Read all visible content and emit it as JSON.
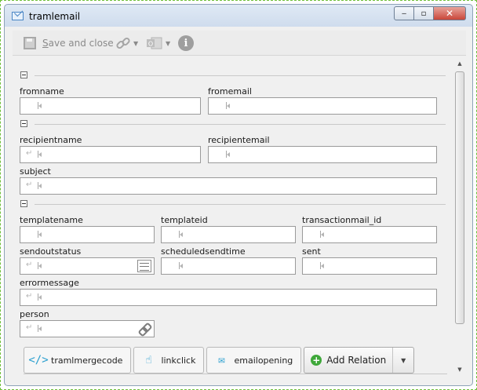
{
  "window": {
    "title": "tramlemail",
    "minimize": "‒",
    "maximize": "▫",
    "close": "✕"
  },
  "toolbar": {
    "save_and_close_underlined": "S",
    "save_and_close_rest": "ave and close",
    "link_caret": "▼",
    "office_caret": "▼",
    "info": "i"
  },
  "sections": [
    {
      "fields": [
        {
          "label": "fromname",
          "value": ""
        },
        {
          "label": "fromemail",
          "value": ""
        }
      ]
    },
    {
      "fields": [
        {
          "label": "recipientname",
          "value": ""
        },
        {
          "label": "recipientemail",
          "value": ""
        },
        {
          "label": "subject",
          "value": ""
        }
      ]
    },
    {
      "fields": [
        {
          "label": "templatename",
          "value": ""
        },
        {
          "label": "templateid",
          "value": ""
        },
        {
          "label": "transactionmail_id",
          "value": ""
        },
        {
          "label": "sendoutstatus",
          "value": ""
        },
        {
          "label": "scheduledsendtime",
          "value": ""
        },
        {
          "label": "sent",
          "value": ""
        },
        {
          "label": "errormessage",
          "value": ""
        },
        {
          "label": "person",
          "value": ""
        }
      ]
    }
  ],
  "relations": {
    "tabs": [
      {
        "label": "tramlmergecode",
        "icon": "code-icon"
      },
      {
        "label": "linkclick",
        "icon": "hand-pointer-icon"
      },
      {
        "label": "emailopening",
        "icon": "envelope-open-icon"
      }
    ],
    "add_relation_label": "Add Relation",
    "add_relation_caret": "▼"
  },
  "scrollbar": {
    "up": "▲",
    "down": "▼"
  }
}
